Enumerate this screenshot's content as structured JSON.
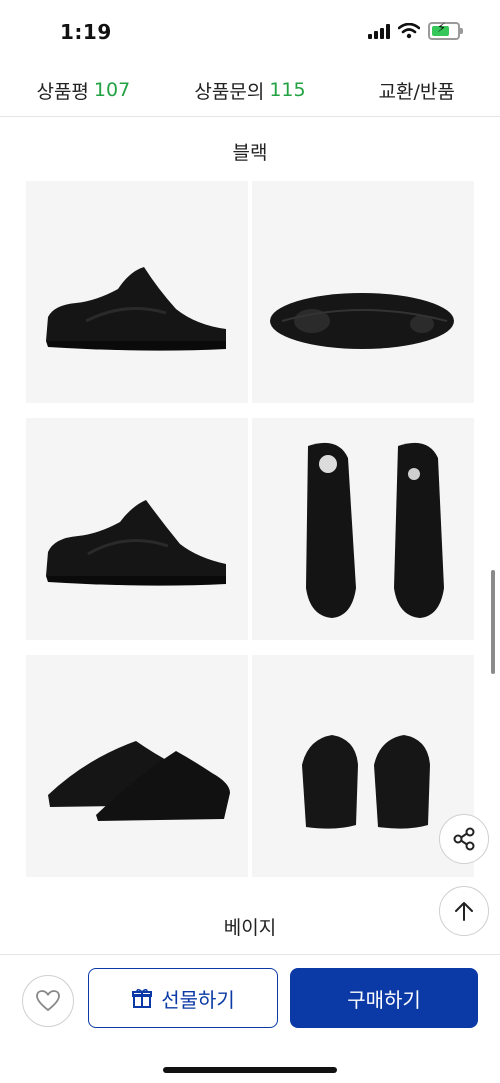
{
  "status_bar": {
    "time": "1:19"
  },
  "tabs": [
    {
      "label": "상품평",
      "count": "107"
    },
    {
      "label": "상품문의",
      "count": "115"
    },
    {
      "label": "교환/반품",
      "count": ""
    }
  ],
  "sections": [
    {
      "title": "블랙"
    },
    {
      "title": "베이지"
    }
  ],
  "images": [
    "side-view",
    "sole-view",
    "side-view-angle",
    "top-view",
    "pair-three-quarter",
    "heel-view"
  ],
  "bottom_bar": {
    "gift_label": "선물하기",
    "buy_label": "구매하기"
  },
  "colors": {
    "accent": "#0b3aa6",
    "count_green": "#23a244",
    "tile_bg": "#f5f5f5"
  }
}
